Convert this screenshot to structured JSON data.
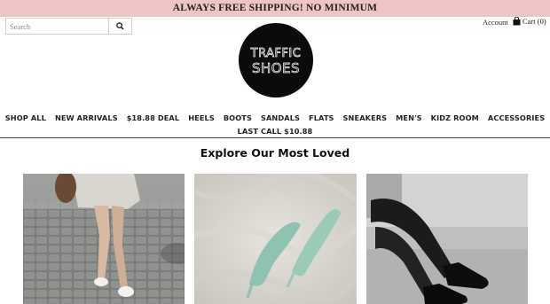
{
  "promo": {
    "text": "ALWAYS FREE SHIPPING! NO MINIMUM"
  },
  "search": {
    "placeholder": "Search"
  },
  "header": {
    "account_label": "Account",
    "cart_label": "Cart (0)",
    "logo_line1": "TRAFFIC",
    "logo_line2": "SHOES"
  },
  "nav": {
    "row1": [
      {
        "label": "SHOP ALL"
      },
      {
        "label": "NEW ARRIVALS"
      },
      {
        "label": "$18.88 DEAL"
      },
      {
        "label": "HEELS"
      },
      {
        "label": "BOOTS"
      },
      {
        "label": "SANDALS"
      },
      {
        "label": "FLATS"
      },
      {
        "label": "SNEAKERS"
      },
      {
        "label": "MEN'S"
      },
      {
        "label": "KIDZ ROOM"
      },
      {
        "label": "ACCESSORIES"
      }
    ],
    "row2": [
      {
        "label": "LAST CALL $10.88"
      }
    ]
  },
  "main": {
    "section_title": "Explore Our Most Loved"
  },
  "colors": {
    "promo_bg": "#efc4c4",
    "logo_bg": "#0b0b0b",
    "text": "#222222"
  },
  "icons": {
    "search": "search-icon",
    "cart": "shopping-bag-icon"
  }
}
